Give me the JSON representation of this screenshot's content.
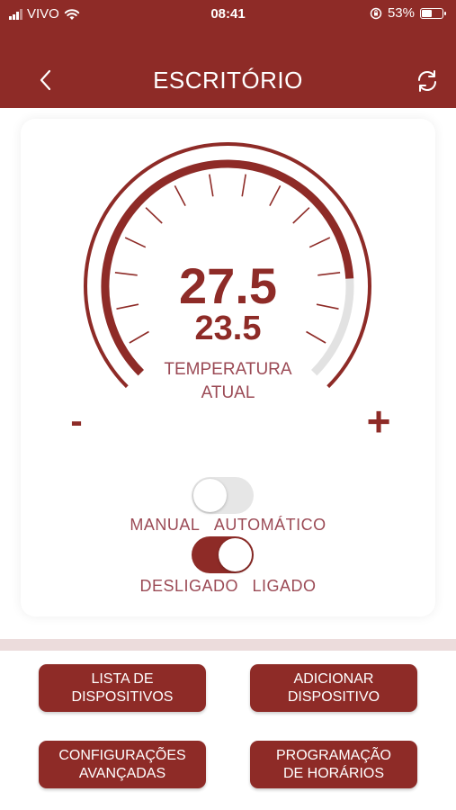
{
  "status_bar": {
    "carrier": "VIVO",
    "time": "08:41",
    "battery_percent": "53%",
    "battery_level": 0.53
  },
  "header": {
    "title": "ESCRITÓRIO",
    "back_icon": "chevron-left-icon",
    "refresh_icon": "refresh-icon",
    "background_color": "#8e2b27"
  },
  "thermostat": {
    "current_temperature": "27.5",
    "target_temperature": "23.5",
    "label": "TEMPERATURA\nATUAL",
    "decrease_label": "-",
    "increase_label": "+",
    "gauge_fill_fraction": 0.82
  },
  "toggles": {
    "mode": {
      "off_label": "MANUAL",
      "on_label": "AUTOMÁTICO",
      "state": false
    },
    "power": {
      "off_label": "DESLIGADO",
      "on_label": "LIGADO",
      "state": true
    }
  },
  "actions": {
    "device_list": "LISTA DE\nDISPOSITIVOS",
    "add_device": "ADICIONAR\nDISPOSITIVO",
    "advanced_settings": "CONFIGURAÇÕES\nAVANÇADAS",
    "schedule": "PROGRAMAÇÃO\nDE HORÁRIOS"
  },
  "colors": {
    "accent": "#8e2b27",
    "label_text": "#9b4a55",
    "track_inactive": "#e2e2e2"
  }
}
